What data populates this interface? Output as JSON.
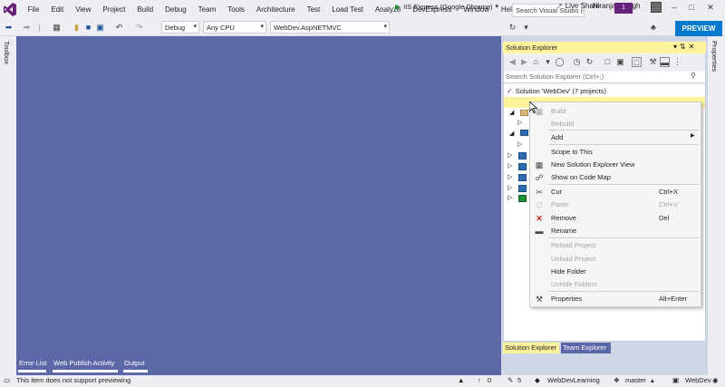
{
  "menubar": {
    "items": [
      "File",
      "Edit",
      "View",
      "Project",
      "Build",
      "Debug",
      "Team",
      "Tools",
      "Architecture",
      "Test",
      "Load Test",
      "Analyze",
      "DevExpress",
      "Window",
      "Help"
    ],
    "search_placeholder": "Search Visual Studio (C",
    "user_name": "Niranjan Singh",
    "notification_count": "1"
  },
  "toolbar": {
    "configuration": "Debug",
    "platform": "Any CPU",
    "startup_project": "WebDev.AspNETMVC",
    "run_target": "IIS Express (Google Chrome)",
    "live_share": "Live Share",
    "preview": "PREVIEW"
  },
  "side_tabs": {
    "left": "Toolbox",
    "right": "Properties"
  },
  "solution_explorer": {
    "title": "Solution Explorer",
    "search_placeholder": "Search Solution Explorer (Ctrl+;)",
    "solution_label": "Solution 'WebDev' (7 projects)",
    "bottom_tabs": [
      "Solution Explorer",
      "Team Explorer"
    ]
  },
  "context_menu": {
    "groups": [
      [
        {
          "label": "Build",
          "enabled": false,
          "icon": "build-icon"
        },
        {
          "label": "Rebuild",
          "enabled": false,
          "icon": ""
        }
      ],
      [
        {
          "label": "Add",
          "enabled": true,
          "icon": "",
          "submenu": true
        }
      ],
      [
        {
          "label": "Scope to This",
          "enabled": true,
          "icon": ""
        },
        {
          "label": "New Solution Explorer View",
          "enabled": true,
          "icon": "new-view-icon"
        },
        {
          "label": "Show on Code Map",
          "enabled": true,
          "icon": "code-map-icon"
        }
      ],
      [
        {
          "label": "Cut",
          "enabled": true,
          "icon": "scissors-icon",
          "shortcut": "Ctrl+X"
        },
        {
          "label": "Paste",
          "enabled": false,
          "icon": "paste-icon",
          "shortcut": "Ctrl+V"
        },
        {
          "label": "Remove",
          "enabled": true,
          "icon": "remove-icon",
          "shortcut": "Del"
        },
        {
          "label": "Rename",
          "enabled": true,
          "icon": "rename-icon"
        }
      ],
      [
        {
          "label": "Reload Project",
          "enabled": false,
          "icon": ""
        },
        {
          "label": "Unload Project",
          "enabled": false,
          "icon": ""
        },
        {
          "label": "Hide Folder",
          "enabled": true,
          "icon": ""
        },
        {
          "label": "Unhide Folders",
          "enabled": false,
          "icon": ""
        }
      ],
      [
        {
          "label": "Properties",
          "enabled": true,
          "icon": "wrench-icon",
          "shortcut": "Alt+Enter"
        }
      ]
    ]
  },
  "bottom_tabs": [
    "Error List",
    "Web Publish Activity",
    "Output"
  ],
  "statusbar": {
    "message": "This item does not support previewing",
    "up_count": "0",
    "pending_changes": "5",
    "repository": "WebDevLearning",
    "branch": "master",
    "project": "WebDev"
  },
  "colors": {
    "editor_background": "#5b67a6",
    "accent": "#007acc",
    "selection_yellow": "#fff29d",
    "vs_purple": "#68217a"
  }
}
